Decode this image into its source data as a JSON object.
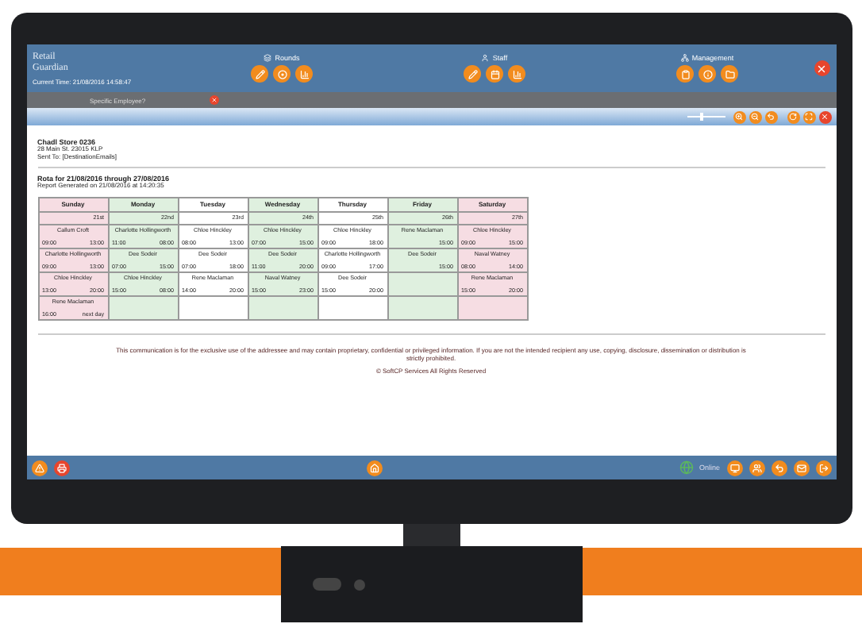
{
  "header": {
    "logo_lines": [
      "Retail",
      "Guardian"
    ],
    "current_time": "Current Time: 21/08/2016 14:58:47",
    "sections": [
      {
        "label": "Rounds",
        "kind": "rounds"
      },
      {
        "label": "Staff",
        "kind": "staff"
      },
      {
        "label": "Management",
        "kind": "management"
      }
    ]
  },
  "tab": {
    "label": "Specific Employee?"
  },
  "viewer": {
    "zoom_slider": {
      "level": 0.4
    }
  },
  "report": {
    "store_name": "Chadl Store 0236",
    "address": "28 Main St. 23015 KLP",
    "sent_to": "Sent To: [DestinationEmails]",
    "title": "Rota for 21/08/2016 through 27/08/2016",
    "generated": "Report Generated on 21/08/2016 at 14:20:35",
    "days": [
      {
        "name": "Sunday",
        "date": "21st",
        "color": "#f6dde3",
        "shifts": [
          {
            "name": "Callum Croft",
            "start": "09:00",
            "end": "13:00"
          },
          {
            "name": "Charlotte Hollingworth",
            "start": "09:00",
            "end": "13:00"
          },
          {
            "name": "Chloe Hinckley",
            "start": "13:00",
            "end": "20:00"
          },
          {
            "name": "Rene Maclaman",
            "start": "16:00",
            "end": "next day"
          }
        ]
      },
      {
        "name": "Monday",
        "date": "22nd",
        "color": "#dff0df",
        "shifts": [
          {
            "name": "Charlotte Hollingworth",
            "start": "11:00",
            "end": "08:00"
          },
          {
            "name": "Dee Sodeir",
            "start": "07:00",
            "end": "15:00"
          },
          {
            "name": "Chloe Hinckley",
            "start": "15:00",
            "end": "08:00"
          }
        ]
      },
      {
        "name": "Tuesday",
        "date": "23rd",
        "color": "#ffffff",
        "shifts": [
          {
            "name": "Chloe Hinckley",
            "start": "08:00",
            "end": "13:00"
          },
          {
            "name": "Dee Sodeir",
            "start": "07:00",
            "end": "18:00"
          },
          {
            "name": "Rene Maclaman",
            "start": "14:00",
            "end": "20:00"
          }
        ]
      },
      {
        "name": "Wednesday",
        "date": "24th",
        "color": "#dff0df",
        "shifts": [
          {
            "name": "Chloe Hinckley",
            "start": "07:00",
            "end": "15:00"
          },
          {
            "name": "Dee Sodeir",
            "start": "11:00",
            "end": "20:00"
          },
          {
            "name": "Naval Watney",
            "start": "15:00",
            "end": "23:00"
          }
        ]
      },
      {
        "name": "Thursday",
        "date": "25th",
        "color": "#ffffff",
        "shifts": [
          {
            "name": "Chloe Hinckley",
            "start": "09:00",
            "end": "18:00"
          },
          {
            "name": "Charlotte Hollingworth",
            "start": "09:00",
            "end": "17:00"
          },
          {
            "name": "Dee Sodeir",
            "start": "15:00",
            "end": "20:00"
          }
        ]
      },
      {
        "name": "Friday",
        "date": "26th",
        "color": "#dff0df",
        "shifts": [
          {
            "name": "Rene Maclaman",
            "end": "15:00"
          },
          {
            "name": "Dee Sodeir",
            "end": "15:00"
          }
        ]
      },
      {
        "name": "Saturday",
        "date": "27th",
        "color": "#f6dde3",
        "shifts": [
          {
            "name": "Chloe Hinckley",
            "start": "09:00",
            "end": "15:00"
          },
          {
            "name": "Naval Watney",
            "start": "08:00",
            "end": "14:00"
          },
          {
            "name": "Rene Maclaman",
            "start": "15:00",
            "end": "20:00"
          }
        ]
      }
    ],
    "disclaimer": "This communication is for the exclusive use of the addressee and may contain proprietary, confidential or privileged information. If you are not the intended recipient any use, copying, disclosure, dissemination or distribution is strictly prohibited.",
    "copyright": "© SoftCP Services All Rights Reserved"
  },
  "status_bar": {
    "online_label": "Online"
  }
}
